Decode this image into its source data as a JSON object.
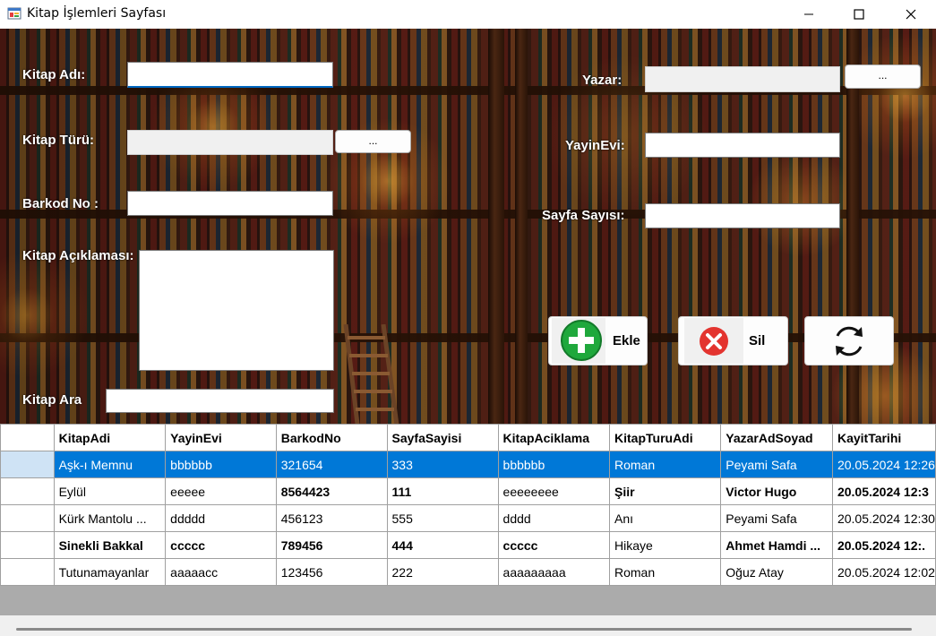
{
  "window": {
    "title": "Kitap İşlemleri Sayfası"
  },
  "form": {
    "kitap_adi_label": "Kitap Adı:",
    "kitap_turu_label": "Kitap Türü:",
    "barkod_label": "Barkod No :",
    "aciklama_label": "Kitap Açıklaması:",
    "kitap_ara_label": "Kitap Ara",
    "yazar_label": "Yazar:",
    "yayinevi_label": "YayinEvi:",
    "sayfa_label": "Sayfa Sayısı:",
    "browse_label": "...",
    "kitap_adi_value": "",
    "kitap_turu_value": "",
    "barkod_value": "",
    "aciklama_value": "",
    "kitap_ara_value": "",
    "yazar_value": "",
    "yayinevi_value": "",
    "sayfa_value": ""
  },
  "buttons": {
    "ekle": "Ekle",
    "sil": "Sil"
  },
  "grid": {
    "columns": [
      "KitapAdi",
      "YayinEvi",
      "BarkodNo",
      "SayfaSayisi",
      "KitapAciklama",
      "KitapTuruAdi",
      "YazarAdSoyad",
      "KayitTarihi"
    ],
    "rows": [
      {
        "cells": [
          "Aşk-ı Memnu",
          "bbbbbb",
          "321654",
          "333",
          "bbbbbb",
          "Roman",
          "Peyami Safa",
          "20.05.2024 12:26"
        ],
        "selected": true
      },
      {
        "cells": [
          "Eylül",
          "eeeee",
          "8564423",
          "111",
          "eeeeeeee",
          "Şiir",
          "Victor Hugo",
          "20.05.2024 12:3"
        ],
        "selected": false
      },
      {
        "cells": [
          "Kürk Mantolu ...",
          "ddddd",
          "456123",
          "555",
          "dddd",
          "Anı",
          "Peyami Safa",
          "20.05.2024 12:30"
        ],
        "selected": false
      },
      {
        "cells": [
          "Sinekli Bakkal",
          "ccccc",
          "789456",
          "444",
          "ccccc",
          "Hikaye",
          "Ahmet Hamdi ...",
          "20.05.2024 12:."
        ],
        "selected": false
      },
      {
        "cells": [
          "Tutunamayanlar",
          "aaaaacc",
          "123456",
          "222",
          "aaaaaaaaa",
          "Roman",
          "Oğuz Atay",
          "20.05.2024 12:02"
        ],
        "selected": false
      }
    ]
  },
  "colors": {
    "selection": "#0078d7",
    "accent_focus": "#0067c0",
    "add_green": "#1fa83c",
    "delete_red": "#e3342f"
  }
}
